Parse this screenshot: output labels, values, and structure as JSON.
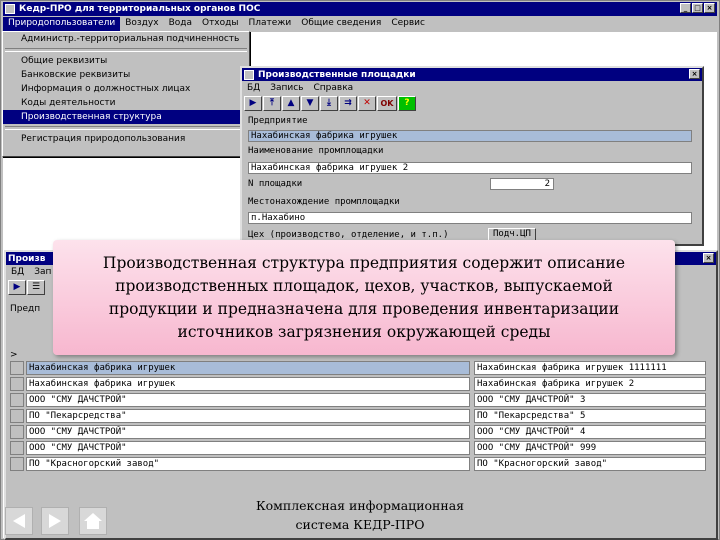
{
  "app": {
    "title": "Кедр-ПРО для территориальных органов ПОС",
    "menu": [
      "Природопользователи",
      "Воздух",
      "Вода",
      "Отходы",
      "Платежи",
      "Общие сведения",
      "Сервис"
    ]
  },
  "dropdown": {
    "items": [
      "Администр.-территориальная подчиненность",
      "Общие реквизиты",
      "Банковские реквизиты",
      "Информация о должностных лицах",
      "Коды деятельности",
      "Производственная структура",
      "Регистрация природопользования"
    ]
  },
  "form_window": {
    "title": "Производственные площадки",
    "menu": [
      "БД",
      "Запись",
      "Справка"
    ],
    "ok_label": "OK",
    "labels": {
      "enterprise": "Предприятие",
      "site_name": "Наименование промплощадки",
      "site_no": "N площадки",
      "location": "Местонахождение промплощадки",
      "workshop": "Цех (производство, отделение, и т.п.)"
    },
    "values": {
      "enterprise": "Нахабинская фабрика игрушек",
      "site_name": "Нахабинская фабрика игрушек 2",
      "site_no": "2",
      "location": "п.Нахабино"
    },
    "workshop_button": "Подч.ЦП"
  },
  "table_window": {
    "title_fragment": "Произв",
    "menu_fragment": [
      "БД",
      "Зап"
    ],
    "label_fragment": "Предп",
    "marker": ">",
    "rows": [
      {
        "name": "Нахабинская фабрика игрушек",
        "site": "Нахабинская фабрика игрушек  1111111"
      },
      {
        "name": "Нахабинская фабрика игрушек",
        "site": "Нахабинская фабрика игрушек 2"
      },
      {
        "name": "ООО \"СМУ ДАЧСТРОЙ\"",
        "site": "ООО \"СМУ ДАЧСТРОЙ\" 3"
      },
      {
        "name": "ПО \"Пекарсредства\"",
        "site": "ПО \"Пекарсредства\" 5"
      },
      {
        "name": "ООО \"СМУ ДАЧСТРОЙ\"",
        "site": "ООО \"СМУ ДАЧСТРОЙ\" 4"
      },
      {
        "name": "ООО \"СМУ ДАЧСТРОЙ\"",
        "site": "ООО \"СМУ ДАЧСТРОЙ\" 999"
      },
      {
        "name": "ПО \"Красногорский завод\"",
        "site": "ПО \"Красногорский завод\""
      }
    ]
  },
  "caption": {
    "lines": [
      "Производственная структура предприятия содержит описание",
      "производственных площадок, цехов, участков, выпускаемой",
      "продукции и предназначена для проведения инвентаризации",
      "источников загрязнения окружающей среды"
    ]
  },
  "footer": {
    "line1": "Комплексная информационная",
    "line2": "система КЕДР-ПРО"
  },
  "colors": {
    "titlebar": "#000080",
    "highlight": "#a8bcd8",
    "caption_bg": "#f7b7cf"
  }
}
